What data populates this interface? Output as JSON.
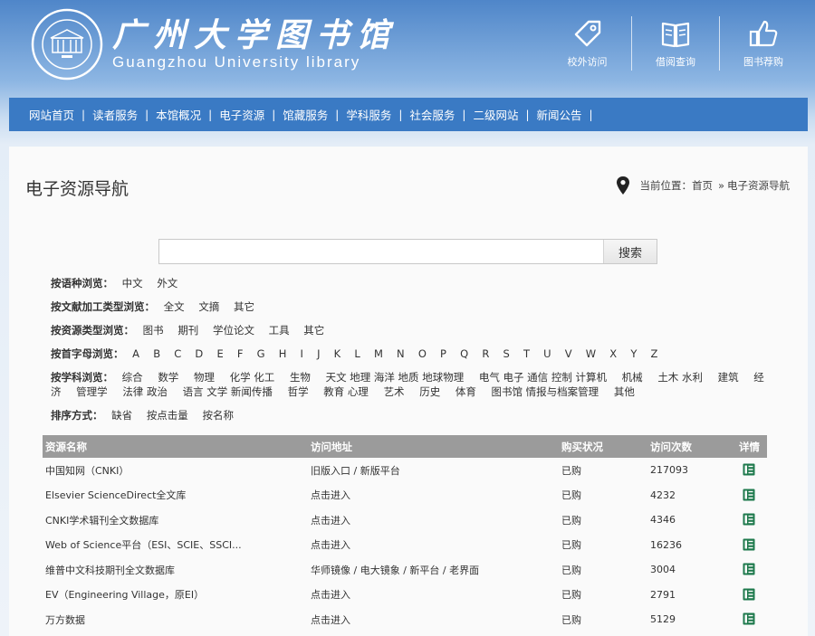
{
  "header": {
    "title_cn": "广州大学图书馆",
    "title_en": "Guangzhou University library",
    "quick_links": [
      {
        "label": "校外访问",
        "icon": "tag-icon"
      },
      {
        "label": "借阅查询",
        "icon": "book-icon"
      },
      {
        "label": "图书荐购",
        "icon": "thumbs-up-icon"
      }
    ]
  },
  "nav": {
    "items": [
      "网站首页",
      "读者服务",
      "本馆概况",
      "电子资源",
      "馆藏服务",
      "学科服务",
      "社会服务",
      "二级网站",
      "新闻公告"
    ],
    "separator": "|"
  },
  "page": {
    "title": "电子资源导航",
    "breadcrumb": {
      "label": "当前位置：",
      "home": "首页",
      "sep": "»",
      "current": "电子资源导航"
    }
  },
  "search": {
    "value": "",
    "placeholder": "",
    "button": "搜索"
  },
  "filters": {
    "language": {
      "label": "按语种浏览：",
      "options": [
        "中文",
        "外文"
      ]
    },
    "processing": {
      "label": "按文献加工类型浏览：",
      "options": [
        "全文",
        "文摘",
        "其它"
      ]
    },
    "resource_type": {
      "label": "按资源类型浏览：",
      "options": [
        "图书",
        "期刊",
        "学位论文",
        "工具",
        "其它"
      ]
    },
    "initial": {
      "label": "按首字母浏览：",
      "options": [
        "A",
        "B",
        "C",
        "D",
        "E",
        "F",
        "G",
        "H",
        "I",
        "J",
        "K",
        "L",
        "M",
        "N",
        "O",
        "P",
        "Q",
        "R",
        "S",
        "T",
        "U",
        "V",
        "W",
        "X",
        "Y",
        "Z"
      ]
    },
    "subject": {
      "label": "按学科浏览：",
      "options": [
        "综合",
        "数学",
        "物理",
        "化学 化工",
        "生物",
        "天文 地理 海洋 地质 地球物理",
        "电气 电子 通信 控制 计算机",
        "机械",
        "土木 水利",
        "建筑",
        "经济",
        "管理学",
        "法律 政治",
        "语言 文学 新闻传播",
        "哲学",
        "教育 心理",
        "艺术",
        "历史",
        "体育",
        "图书馆 情报与档案管理",
        "其他"
      ]
    },
    "sort": {
      "label": "排序方式：",
      "options": [
        "缺省",
        "按点击量",
        "按名称"
      ]
    }
  },
  "table": {
    "headers": [
      "资源名称",
      "访问地址",
      "购买状况",
      "访问次数",
      "详情"
    ],
    "rows": [
      {
        "name": "中国知网（CNKI）",
        "url": "旧版入口 / 新版平台",
        "status": "已购",
        "visits": "217093"
      },
      {
        "name": "Elsevier ScienceDirect全文库",
        "url": "点击进入",
        "status": "已购",
        "visits": "4232"
      },
      {
        "name": "CNKI学术辑刊全文数据库",
        "url": "点击进入",
        "status": "已购",
        "visits": "4346"
      },
      {
        "name": "Web of Science平台（ESI、SCIE、SSCI...",
        "url": "点击进入",
        "status": "已购",
        "visits": "16236"
      },
      {
        "name": "维普中文科技期刊全文数据库",
        "url": "华师镜像 / 电大镜象 / 新平台 / 老界面",
        "status": "已购",
        "visits": "3004"
      },
      {
        "name": "EV（Engineering Village，原EI）",
        "url": "点击进入",
        "status": "已购",
        "visits": "2791"
      },
      {
        "name": "万方数据",
        "url": "点击进入",
        "status": "已购",
        "visits": "5129"
      }
    ]
  },
  "colors": {
    "nav_bg": "#3a7ac4",
    "table_header": "#9b9b9b",
    "detail_icon": "#1f7a4d"
  }
}
